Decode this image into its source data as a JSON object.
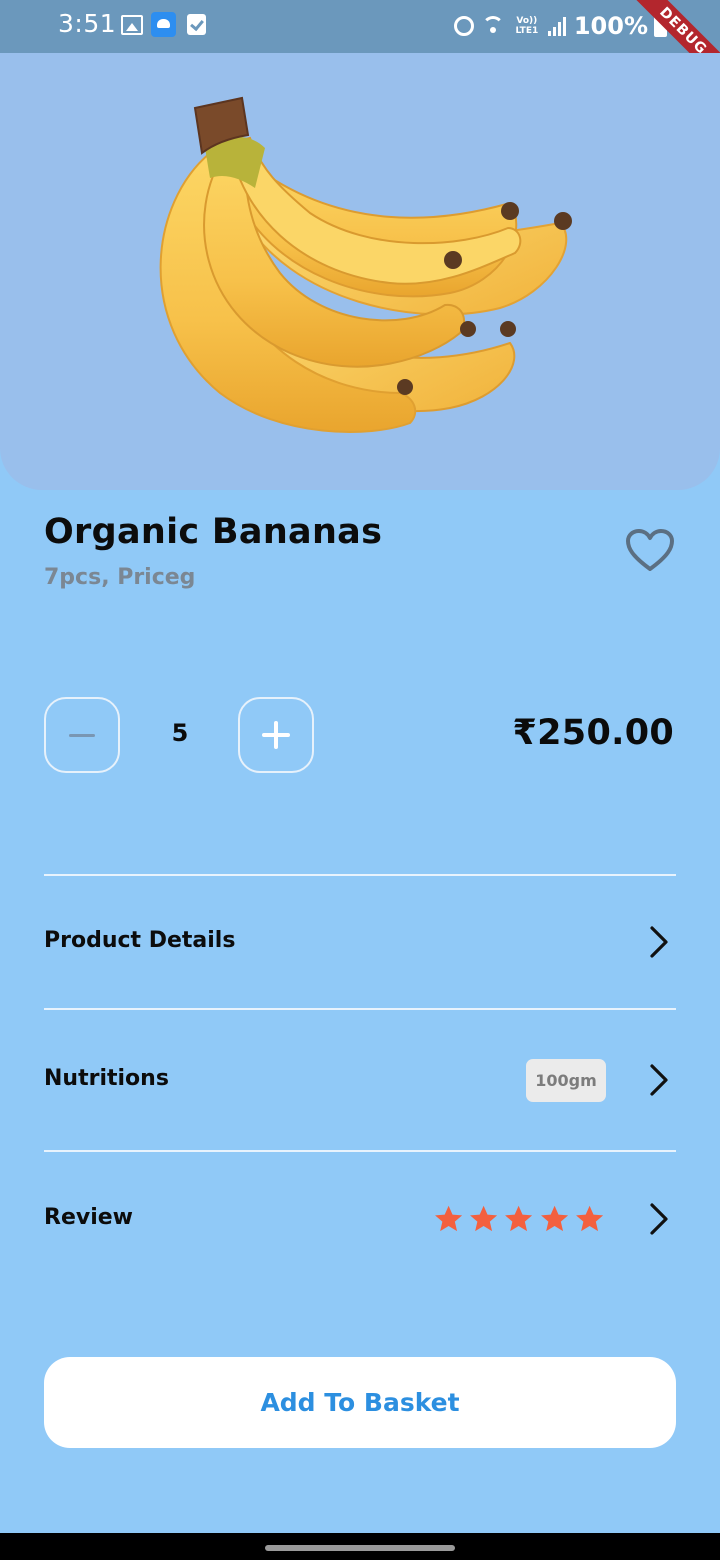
{
  "status_bar": {
    "time": "3:51",
    "network": "Vo)) LTE1",
    "battery": "100%",
    "icons": [
      "gallery-icon",
      "cloud-upload-icon",
      "checkbox-icon",
      "alarm-icon",
      "wifi-icon",
      "signal-icon",
      "battery-icon"
    ]
  },
  "debug_banner": "DEBUG",
  "product": {
    "name": "Organic Bananas",
    "subtitle": "7pcs, Priceg",
    "image": "banana-bunch",
    "favorite_icon": "heart-outline-icon"
  },
  "quantity": {
    "value": "5",
    "decrement_icon": "minus-icon",
    "increment_icon": "plus-icon"
  },
  "price": "₹250.00",
  "rows": {
    "product_details": {
      "label": "Product Details"
    },
    "nutritions": {
      "label": "Nutritions",
      "badge": "100gm"
    },
    "review": {
      "label": "Review",
      "rating": 5,
      "max_rating": 5
    }
  },
  "add_button": {
    "label": "Add To Basket"
  },
  "colors": {
    "background": "#90c9f7",
    "image_background": "#99bfec",
    "status_bar": "#6b98bc",
    "star": "#f3603f",
    "button_text": "#2c8fe0",
    "subtitle": "#7b8793",
    "heart": "#5b6f82"
  }
}
